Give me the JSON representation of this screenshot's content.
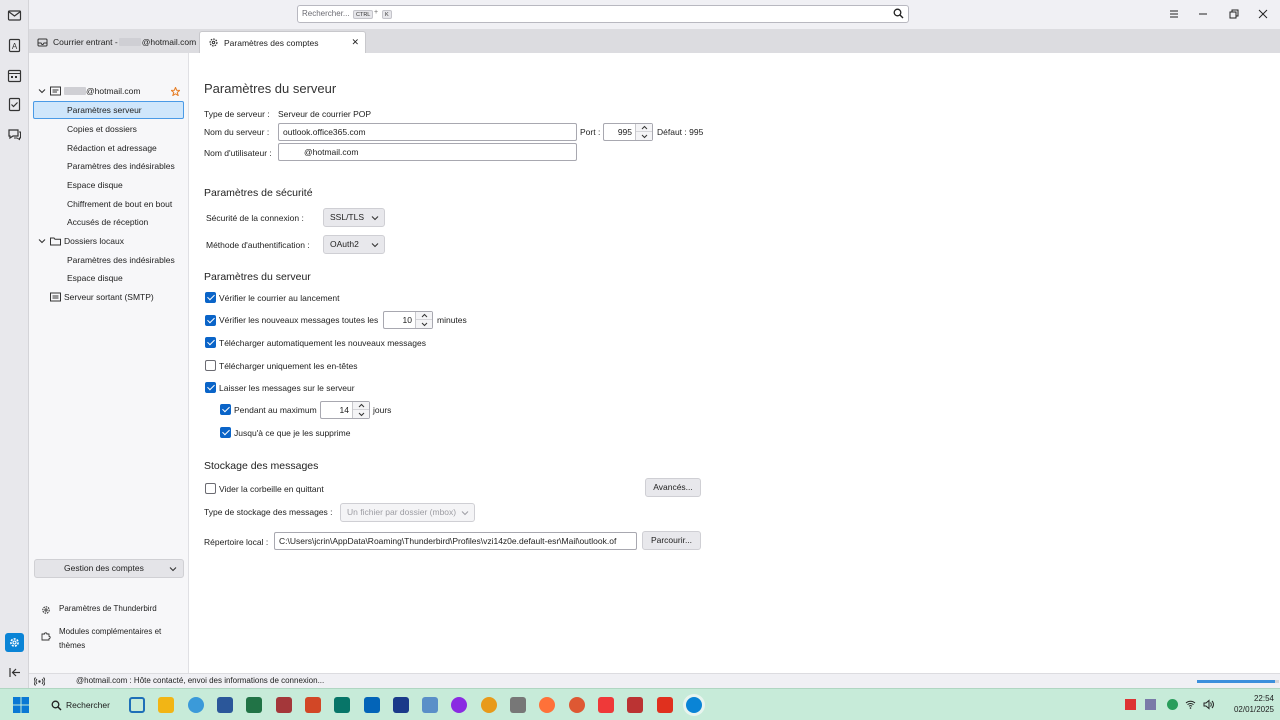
{
  "search": {
    "placeholder": "Rechercher...",
    "shortcut_ctrl": "CTRL",
    "shortcut_plus": "+",
    "shortcut_key": "K"
  },
  "tabs": [
    {
      "label_prefix": "Courrier entrant - ",
      "label_suffix": "@hotmail.com"
    },
    {
      "label": "Paramètres des comptes",
      "close": "✕"
    }
  ],
  "sidebar": {
    "account": "@hotmail.com",
    "account_items": [
      "Paramètres serveur",
      "Copies et dossiers",
      "Rédaction et adressage",
      "Paramètres des indésirables",
      "Espace disque",
      "Chiffrement de bout en bout",
      "Accusés de réception"
    ],
    "local_folders": "Dossiers locaux",
    "local_items": [
      "Paramètres des indésirables",
      "Espace disque"
    ],
    "smtp": "Serveur sortant (SMTP)",
    "account_management": "Gestion des comptes",
    "thunderbird_settings": "Paramètres de Thunderbird",
    "addons": "Modules complémentaires et thèmes"
  },
  "main": {
    "title": "Paramètres du serveur",
    "server_type_label": "Type de serveur :",
    "server_type_value": "Serveur de courrier POP",
    "server_name_label": "Nom du serveur :",
    "server_name_value": "outlook.office365.com",
    "port_label": "Port :",
    "port_value": "995",
    "default_port": "Défaut : 995",
    "username_label": "Nom d'utilisateur :",
    "username_value": "@hotmail.com",
    "security_title": "Paramètres de sécurité",
    "conn_security_label": "Sécurité de la connexion :",
    "conn_security_value": "SSL/TLS",
    "auth_method_label": "Méthode d'authentification :",
    "auth_method_value": "OAuth2",
    "server_settings_title": "Paramètres du serveur",
    "check_startup": "Vérifier le courrier au lancement",
    "check_every": "Vérifier les nouveaux messages toutes les",
    "check_every_value": "10",
    "minutes": "minutes",
    "auto_download": "Télécharger automatiquement les nouveaux messages",
    "headers_only": "Télécharger uniquement les en-têtes",
    "leave_on_server": "Laisser les messages sur le serveur",
    "at_most": "Pendant au maximum",
    "at_most_value": "14",
    "days": "jours",
    "until_delete": "Jusqu'à ce que je les supprime",
    "storage_title": "Stockage des messages",
    "empty_trash": "Vider la corbeille en quittant",
    "advanced": "Avancés...",
    "storage_type_label": "Type de stockage des messages :",
    "storage_type_value": "Un fichier par dossier (mbox)",
    "local_dir_label": "Répertoire local :",
    "local_dir_value": "C:\\Users\\jcrin\\AppData\\Roaming\\Thunderbird\\Profiles\\vzi14z0e.default-esr\\Mail\\outlook.of",
    "browse": "Parcourir..."
  },
  "checks": {
    "check_startup": true,
    "check_every": true,
    "auto_download": true,
    "headers_only": false,
    "leave_on_server": true,
    "at_most": true,
    "until_delete": true,
    "empty_trash": false
  },
  "statusbar": {
    "text": "@hotmail.com : Hôte contacté, envoi des informations de connexion...",
    "progress": 0.95
  },
  "taskbar": {
    "search_label": "Rechercher",
    "time": "22:54",
    "date": "02/01/2025"
  },
  "colors": {
    "accent": "#0a64c8",
    "selection": "#cfe6fb",
    "taskbar": "#c7ebd9"
  }
}
